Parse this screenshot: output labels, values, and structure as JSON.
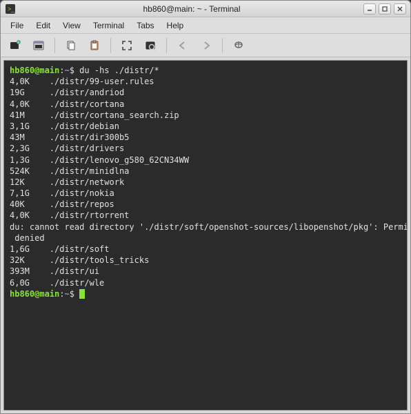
{
  "window": {
    "title": "hb860@main: ~ - Terminal"
  },
  "menubar": {
    "items": [
      "File",
      "Edit",
      "View",
      "Terminal",
      "Tabs",
      "Help"
    ]
  },
  "terminal": {
    "prompt_user": "hb860@main",
    "prompt_path": "~",
    "prompt_symbol": "$",
    "command": "du -hs ./distr/*",
    "rows": [
      {
        "size": "4,0K",
        "path": "./distr/99-user.rules"
      },
      {
        "size": "19G",
        "path": "./distr/andriod"
      },
      {
        "size": "4,0K",
        "path": "./distr/cortana"
      },
      {
        "size": "41M",
        "path": "./distr/cortana_search.zip"
      },
      {
        "size": "3,1G",
        "path": "./distr/debian"
      },
      {
        "size": "43M",
        "path": "./distr/dir300b5"
      },
      {
        "size": "2,3G",
        "path": "./distr/drivers"
      },
      {
        "size": "1,3G",
        "path": "./distr/lenovo_g580_62CN34WW"
      },
      {
        "size": "524K",
        "path": "./distr/minidlna"
      },
      {
        "size": "12K",
        "path": "./distr/network"
      },
      {
        "size": "7,1G",
        "path": "./distr/nokia"
      },
      {
        "size": "40K",
        "path": "./distr/repos"
      },
      {
        "size": "4,0K",
        "path": "./distr/rtorrent"
      }
    ],
    "error_line": "du: cannot read directory './distr/soft/openshot-sources/libopenshot/pkg': Permission denied",
    "rows2": [
      {
        "size": "1,6G",
        "path": "./distr/soft"
      },
      {
        "size": "32K",
        "path": "./distr/tools_tricks"
      },
      {
        "size": "393M",
        "path": "./distr/ui"
      },
      {
        "size": "6,0G",
        "path": "./distr/wle"
      }
    ]
  }
}
